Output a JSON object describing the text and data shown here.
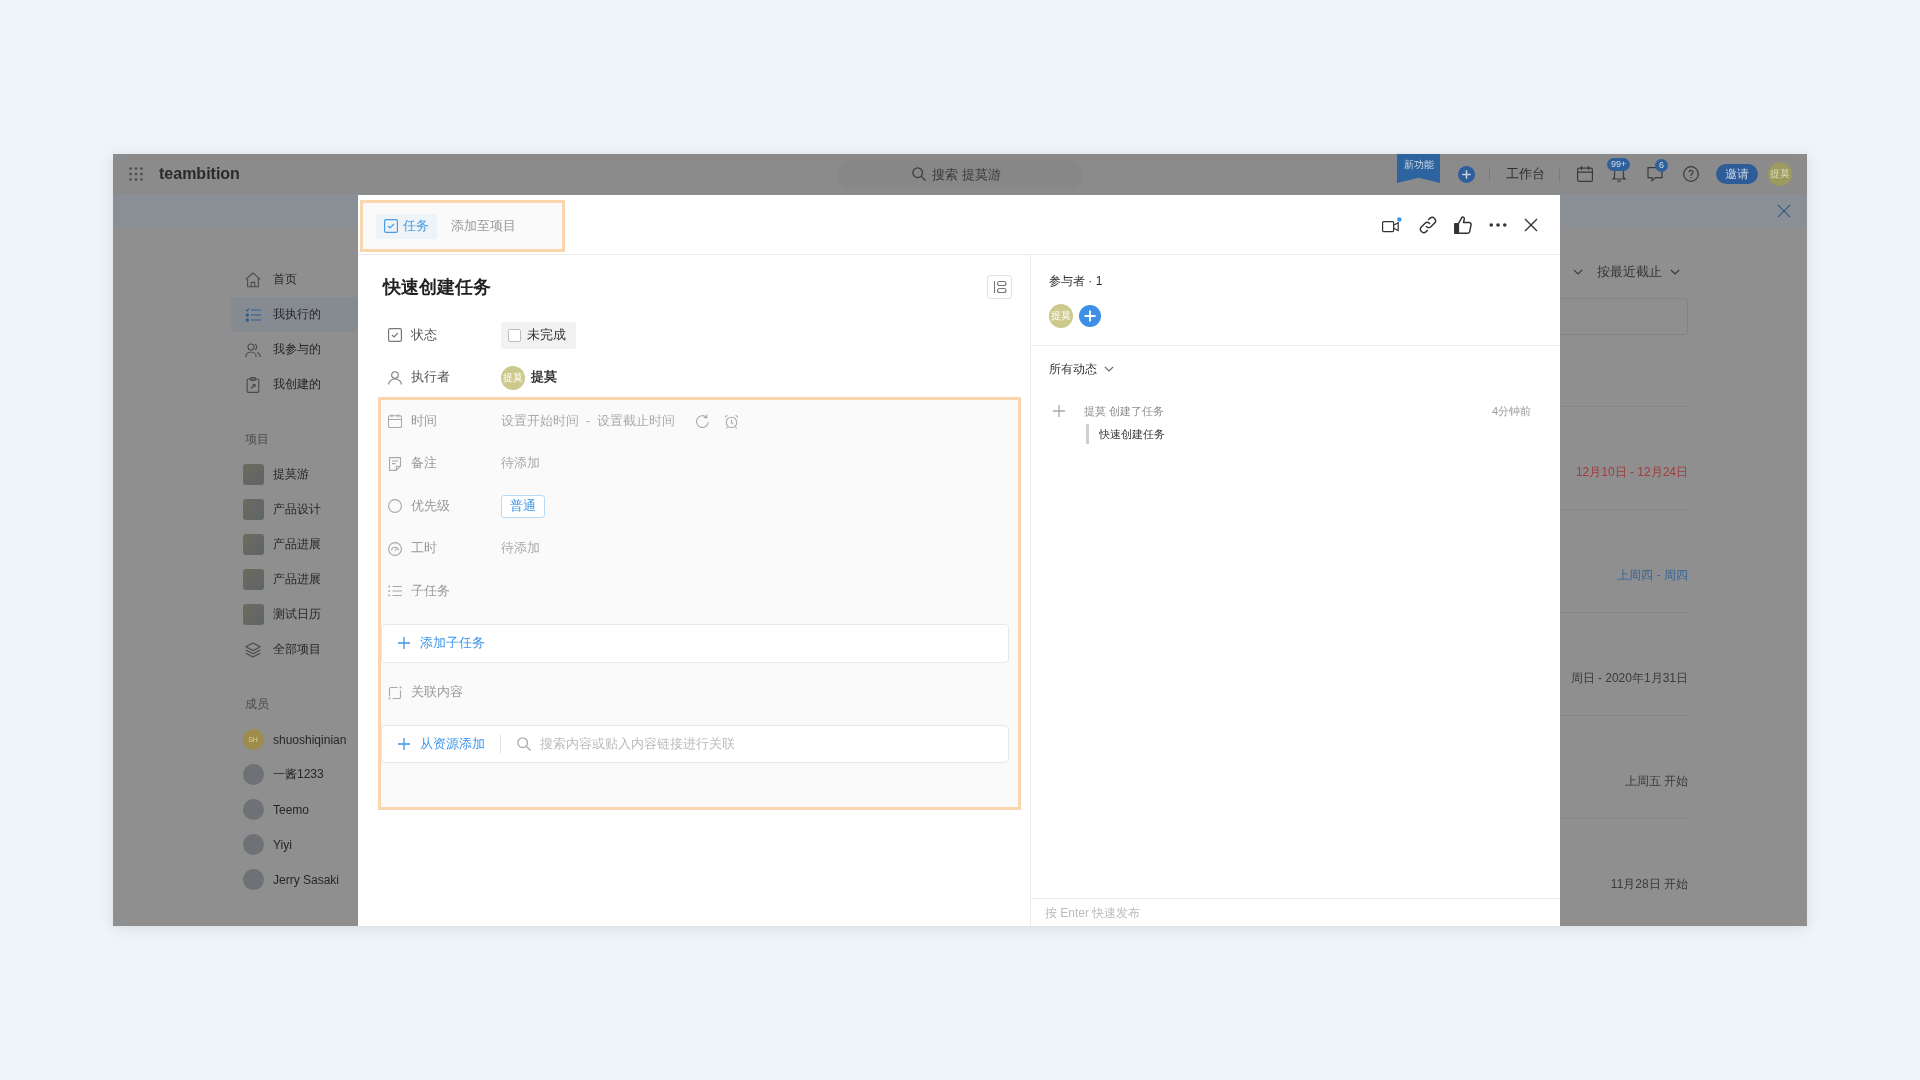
{
  "app_bar": {
    "logo": "teambition",
    "search": {
      "placeholder": "搜索 提莫游"
    },
    "new_badge": "新功能",
    "workbench": "工作台",
    "notifications_count": "99+",
    "messages_count": "6",
    "invite_button": "邀请",
    "avatar": "提莫"
  },
  "sidebar": {
    "nav": [
      {
        "label": "首页",
        "selected": false
      },
      {
        "label": "我执行的",
        "selected": true
      },
      {
        "label": "我参与的",
        "selected": false
      },
      {
        "label": "我创建的",
        "selected": false
      }
    ],
    "projects_heading": "项目",
    "projects": [
      {
        "kind": "project",
        "label": "提莫游"
      },
      {
        "kind": "project",
        "label": "产品设计"
      },
      {
        "kind": "project",
        "label": "产品进展"
      },
      {
        "kind": "project",
        "label": "产品进展"
      },
      {
        "kind": "project",
        "label": "测试日历"
      },
      {
        "kind": "all",
        "label": "全部项目"
      }
    ],
    "members_heading": "成员",
    "members": [
      {
        "name": "shuoshiqinian",
        "initials": "SH"
      },
      {
        "name": "一酱1233"
      },
      {
        "name": "Teemo"
      },
      {
        "name": "Yiyi"
      },
      {
        "name": "Jerry Sasaki"
      }
    ]
  },
  "task_list": {
    "sort": "按最近截止",
    "dates": [
      {
        "text": "12月10日 - 12月24日",
        "color": "#a33b38"
      },
      {
        "text": "上周四 - 周四",
        "color": "#36649a"
      },
      {
        "text": "周日 - 2020年1月31日",
        "color": "#3a3a3a"
      },
      {
        "text": "上周五 开始",
        "color": "#3a3a3a"
      },
      {
        "text": "11月28日 开始",
        "color": "#3a3a3a"
      }
    ]
  },
  "dialog": {
    "tabs": [
      {
        "label": "任务",
        "selected": true
      },
      {
        "label": "添加至项目",
        "selected": false
      }
    ],
    "title": "快速创建任务",
    "fields": [
      {
        "kind": "status",
        "label": "状态",
        "value": "未完成",
        "checked": false
      },
      {
        "kind": "assignee",
        "label": "执行者",
        "avatar": "提莫",
        "value": "提莫"
      }
    ],
    "more_fields": [
      {
        "kind": "time",
        "label": "时间",
        "start": "设置开始时间",
        "separator": "-",
        "end": "设置截止时间"
      },
      {
        "kind": "text",
        "label": "备注",
        "placeholder": "待添加"
      },
      {
        "kind": "priority",
        "label": "优先级",
        "value": "普通"
      },
      {
        "kind": "text",
        "label": "工时",
        "placeholder": "待添加"
      }
    ],
    "subtasks": {
      "label": "子任务",
      "add_button": "添加子任务"
    },
    "links": {
      "label": "关联内容",
      "add_button": "从资源添加",
      "search": {
        "placeholder": "搜索内容或贴入内容链接进行关联"
      }
    },
    "participants": {
      "title": "参与者 · 1",
      "avatars": [
        "提莫"
      ]
    },
    "activity": {
      "filter": "所有动态",
      "items": [
        {
          "text": "提莫 创建了任务",
          "time": "4分钟前",
          "quote": "快速创建任务"
        }
      ]
    },
    "comment": {
      "placeholder": "按 Enter 快速发布"
    }
  }
}
